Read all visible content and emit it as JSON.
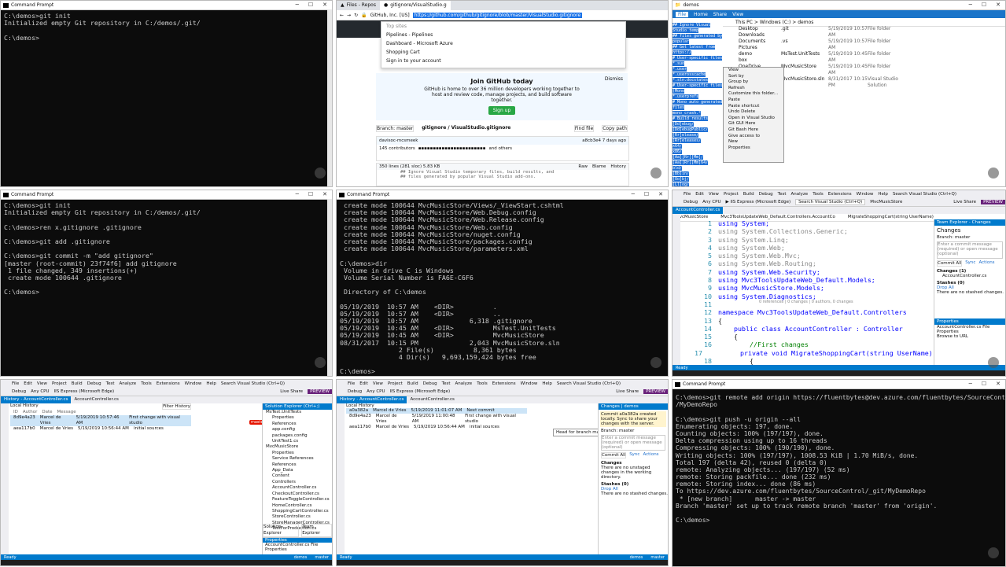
{
  "tile1": {
    "title": "Command Prompt",
    "lines": [
      "C:\\demos>git init",
      "Initialized empty Git repository in C:/demos/.git/",
      "",
      "C:\\demos>"
    ]
  },
  "tile2": {
    "tabs": [
      "Files - Repos",
      "gitignore/VisualStudio.g"
    ],
    "url": "https://github.com/github/gitignore/blob/master/VisualStudio.gitignore",
    "company": "GitHub, Inc. [US]",
    "dropdown": [
      "Top sites",
      "Pipelines - Pipelines",
      "Dashboard - Microsoft Azure",
      "Shopping Cart",
      "Sign in to your account"
    ],
    "join_title": "Join GitHub today",
    "join_text": "GitHub is home to over 36 million developers working together to host and review code, manage projects, and build software together.",
    "signup": "Sign up",
    "dismiss": "Dismiss",
    "branch": "Branch: master",
    "path": "gitignore / VisualStudio.gitignore",
    "find_file": "Find file",
    "copy_path": "Copy path",
    "commit_author": "davisoc-mcsmeek",
    "commit_time": "a8cb3e4 7 days ago",
    "contributors": "145 contributors",
    "and_others": "and others",
    "file_info": "350 lines (281 sloc)   5.83 KB",
    "raw": "Raw",
    "blame": "Blame",
    "history": "History",
    "code1": "## Ignore Visual Studio temporary files, build results, and",
    "code2": "## files generated by popular Visual Studio add-ons."
  },
  "tile3": {
    "title": "demos",
    "ribbon": [
      "File",
      "Home",
      "Share",
      "View"
    ],
    "path": "This PC > Windows (C:) > demos",
    "nav": [
      "Desktop",
      "Downloads",
      "Documents",
      "Pictures",
      "demo",
      "box",
      "OneDrive",
      "This PC",
      "Network"
    ],
    "files": [
      {
        "name": ".git",
        "date": "5/19/2019 10:57 AM",
        "type": "File folder"
      },
      {
        "name": ".vs",
        "date": "5/19/2019 10:57 AM",
        "type": "File folder"
      },
      {
        "name": "MsTest.UnitTests",
        "date": "5/19/2019 10:45 AM",
        "type": "File folder"
      },
      {
        "name": "MvcMusicStore",
        "date": "5/19/2019 10:45 AM",
        "type": "File folder"
      },
      {
        "name": "MvcMusicStore.sln",
        "date": "8/31/2017 10:15 PM",
        "type": "Visual Studio Solution"
      }
    ],
    "menu": [
      "View",
      "Sort by",
      "Group by",
      "Refresh",
      "Customize this folder...",
      "Paste",
      "Paste shortcut",
      "Undo Delete",
      "Open in Visual Studio",
      "Git GUI Here",
      "Git Bash Here",
      "Give access to",
      "New",
      "Properties"
    ],
    "blue": [
      "## Ignore Visual Studio temp",
      "## files generated by popular",
      "",
      "## Get latest from https://",
      "",
      "# User-specific files",
      "*.suo",
      "*.user",
      "*.userosscache",
      "*.sln.docstates",
      "",
      "# User-specific files (Mono",
      "*.userprefs",
      "",
      "# Mono auto generated files",
      "mono_crash.*",
      "",
      "# Build results",
      "[Dd]ebug/",
      "[Dd]ebugPublic/",
      "[Rr]elease/",
      "[Rr]eleases/",
      "x64/",
      "x86/",
      "[Aa][Rr][Mm]/",
      "[Aa][Rr][Mm]64/",
      "bld/",
      "[Bb]in/",
      "[Oo]bj/",
      "[Ll]og/",
      "",
      "# Visual Studio 2015/2017 c",
      "",
      "# Uncomment if you have tasks that create the project's static files in wwwroot",
      "#wwwroot/",
      "",
      "# Visual Studio 2017 auto generated files",
      "Generated\\ Files/"
    ]
  },
  "tile4": {
    "title": "Command Prompt",
    "lines": [
      "C:\\demos>git init",
      "Initialized empty Git repository in C:/demos/.git/",
      "",
      "C:\\demos>ren x.gitignore .gitignore",
      "",
      "C:\\demos>git add .gitignore",
      "",
      "C:\\demos>git commit -m \"add gitignore\"",
      "[master (root-commit) 23f74f6] add gitignore",
      " 1 file changed, 349 insertions(+)",
      " create mode 100644 .gitignore",
      "",
      "C:\\demos>"
    ]
  },
  "tile5": {
    "title": "Command Prompt",
    "lines": [
      " create mode 100644 MvcMusicStore/Views/_ViewStart.cshtml",
      " create mode 100644 MvcMusicStore/Web.Debug.config",
      " create mode 100644 MvcMusicStore/Web.Release.config",
      " create mode 100644 MvcMusicStore/Web.config",
      " create mode 100644 MvcMusicStore/nuget.config",
      " create mode 100644 MvcMusicStore/packages.config",
      " create mode 100644 MvcMusicStore/parameters.xml",
      "",
      "C:\\demos>dir",
      " Volume in drive C is Windows",
      " Volume Serial Number is FA6E-C6F6",
      "",
      " Directory of C:\\demos",
      "",
      "05/19/2019  10:57 AM    <DIR>          .",
      "05/19/2019  10:57 AM    <DIR>          ..",
      "05/19/2019  10:57 AM             6,318 .gitignore",
      "05/19/2019  10:45 AM    <DIR>          MsTest.UnitTests",
      "05/19/2019  10:45 AM    <DIR>          MvcMusicStore",
      "08/31/2017  10:15 PM             2,043 MvcMusicStore.sln",
      "               2 File(s)          8,361 bytes",
      "               4 Dir(s)   9,693,159,424 bytes free",
      "",
      "C:\\demos>"
    ]
  },
  "tile6": {
    "menu": [
      "File",
      "Edit",
      "View",
      "Project",
      "Build",
      "Debug",
      "Test",
      "Analyze",
      "Tools",
      "Extensions",
      "Window",
      "Help"
    ],
    "search": "Search Visual Studio (Ctrl+Q)",
    "solution": "MvcMusicStore",
    "liveshare": "Live Share",
    "preview": "PREVIEW",
    "debug": "Debug",
    "cpu": "Any CPU",
    "iis": "IIS Express (Microsoft Edge)",
    "tab": "AccountController.cs",
    "nav1": "MvcMusicStore",
    "nav2": "Mvc3ToolsUpdateWeb_Default.Controllers.AccountCo",
    "nav3": "MigrateShoppingCart(string UserName)",
    "te_title": "Team Explorer - Changes",
    "te_changes": "Changes",
    "te_branch": "Branch: master",
    "te_msg": "Enter a commit message (required) or open message (optional)",
    "commit_all": "Commit All",
    "sync": "Sync",
    "actions": "Actions",
    "te_changes_count": "Changes (1)",
    "te_file": "AccountController.cs",
    "stashes": "Stashes (0)",
    "drop_all": "Drop All",
    "no_stashes": "There are no stashed changes.",
    "props_title": "Properties",
    "props_file": "AccountController.cs File Properties",
    "browse": "Browse to URL",
    "status": "Ready",
    "ref_hint": "0 references | 0 changes | 0 authors, 0 changes",
    "code": [
      {
        "n": "1",
        "t": "using System;",
        "c": "kw"
      },
      {
        "n": "2",
        "t": "using System.Collections.Generic;",
        "c": "gray"
      },
      {
        "n": "3",
        "t": "using System.Linq;",
        "c": "gray"
      },
      {
        "n": "4",
        "t": "using System.Web;",
        "c": "gray"
      },
      {
        "n": "5",
        "t": "using System.Web.Mvc;",
        "c": "gray"
      },
      {
        "n": "6",
        "t": "using System.Web.Routing;",
        "c": "gray"
      },
      {
        "n": "7",
        "t": "using System.Web.Security;",
        "c": "kw"
      },
      {
        "n": "8",
        "t": "using Mvc3ToolsUpdateWeb_Default.Models;",
        "c": "kw"
      },
      {
        "n": "9",
        "t": "using MvcMusicStore.Models;",
        "c": "kw"
      },
      {
        "n": "10",
        "t": "using System.Diagnostics;",
        "c": "kw"
      },
      {
        "n": "11",
        "t": "",
        "c": ""
      },
      {
        "n": "12",
        "t": "namespace Mvc3ToolsUpdateWeb_Default.Controllers",
        "c": "kw"
      },
      {
        "n": "13",
        "t": "{",
        "c": ""
      },
      {
        "n": "14",
        "t": "    public class AccountController : Controller",
        "c": "kw"
      },
      {
        "n": "15",
        "t": "    {",
        "c": ""
      },
      {
        "n": "16",
        "t": "        //First changes",
        "c": "cm"
      },
      {
        "n": "17",
        "t": "        private void MigrateShoppingCart(string UserName)",
        "c": "kw"
      },
      {
        "n": "18",
        "t": "        {",
        "c": ""
      },
      {
        "n": "19",
        "t": "            // Associate shopping cart items with logged-in user",
        "c": "cm"
      },
      {
        "n": "20",
        "t": "            var cart = ShoppingCart.GetCart(this.HttpContext);",
        "c": "kw"
      },
      {
        "n": "21",
        "t": "",
        "c": ""
      }
    ]
  },
  "tile7": {
    "tabs": [
      "History - AccountController.cs",
      "AccountController.cs"
    ],
    "local_history": "Local History",
    "filter": "Filter History",
    "cols": [
      "ID",
      "Author",
      "Date",
      "Message"
    ],
    "rows": [
      {
        "id": "8d9e4a23",
        "author": "Marcel de Vries",
        "date": "5/19/2019 10:57:46 AM",
        "msg": "First change with visual studio"
      },
      {
        "id": "aea117b0",
        "author": "Marcel de Vries",
        "date": "5/19/2019 10:56:44 AM",
        "msg": "initial sources"
      }
    ],
    "master": "master",
    "sol_title": "Solution Explorer (Ctrl+;)",
    "sol_items": [
      "MsTest.UnitTests",
      "Properties",
      "References",
      "app.config",
      "packages.config",
      "UnitTest1.cs",
      "MvcMusicStore",
      "Properties",
      "Service References",
      "References",
      "App_Data",
      "Content",
      "Controllers",
      "AccountController.cs",
      "CheckoutController.cs",
      "FeatureToggleController.cs",
      "HomeController.cs",
      "ShoppingCartController.cs",
      "StoreController.cs",
      "StoreManagerController.cs",
      "TestForProduction.cs"
    ],
    "sol_tab1": "Solution Explorer",
    "sol_tab2": "Team Explorer",
    "props": "Properties",
    "prop_file": "AccountController.cs File Properties",
    "status": "Ready",
    "bottom_user": "demos",
    "bottom_branch": "master"
  },
  "tile8": {
    "tabs": [
      "History - AccountController.cs",
      "AccountController.cs"
    ],
    "local_history": "Local History",
    "rows": [
      {
        "id": "a0a382a",
        "author": "Marcel de Vries",
        "date": "5/19/2019 11:01:07 AM",
        "msg": "Next commit"
      },
      {
        "id": "8d9e4a23",
        "author": "Marcel de Vries",
        "date": "5/19/2019 11:00:48 AM",
        "msg": "First change with visual studio"
      },
      {
        "id": "aea117b0",
        "author": "Marcel de Vries",
        "date": "5/19/2019 10:56:44 AM",
        "msg": "initial sources"
      }
    ],
    "tip": "Head for branch master",
    "te_title": "Changes | demos",
    "notice": "Commit a0a382a created locally. Sync to share your changes with the server.",
    "branch": "Branch: master",
    "msg_placeholder": "Enter a commit message (required) or open message (optional)",
    "commit_all": "Commit All",
    "sync": "Sync",
    "actions": "Actions",
    "changes": "Changes",
    "no_changes": "There are no unstaged changes in the working directory.",
    "stashes": "Stashes (0)",
    "drop_all": "Drop All",
    "no_stashes": "There are no stashed changes.",
    "status": "Ready"
  },
  "tile9": {
    "title": "Command Prompt",
    "lines": [
      "C:\\demos>git remote add origin https://fluentbytes@dev.azure.com/fluentbytes/SourceControl/_git",
      "/MyDemoRepo",
      "",
      "C:\\demos>git push -u origin --all",
      "Enumerating objects: 197, done.",
      "Counting objects: 100% (197/197), done.",
      "Delta compression using up to 16 threads",
      "Compressing objects: 100% (190/190), done.",
      "Writing objects: 100% (197/197), 1008.53 KiB | 1.70 MiB/s, done.",
      "Total 197 (delta 42), reused 0 (delta 0)",
      "remote: Analyzing objects... (197/197) (52 ms)",
      "remote: Storing packfile... done (232 ms)",
      "remote: Storing index... done (86 ms)",
      "To https://dev.azure.com/fluentbytes/SourceControl/_git/MyDemoRepo",
      " * [new branch]      master -> master",
      "Branch 'master' set up to track remote branch 'master' from 'origin'.",
      "",
      "C:\\demos>"
    ]
  }
}
